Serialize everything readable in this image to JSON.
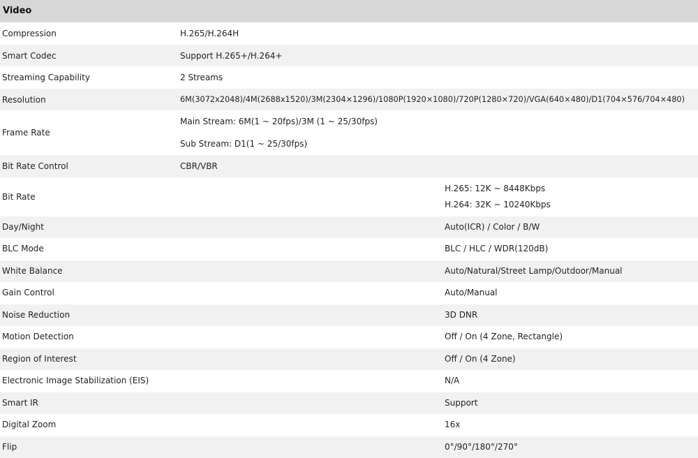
{
  "title": "Video",
  "rows": [
    {
      "label": "Compression",
      "values": [
        "H.265/H.264H"
      ]
    },
    {
      "label": "Smart Codec",
      "values": [
        "Support H.265+/H.264+"
      ]
    },
    {
      "label": "Streaming Capability",
      "values": [
        "2 Streams"
      ]
    },
    {
      "label": "Resolution",
      "values": [
        "6M(3072x2048)/4M(2688x1520)/3M(2304×1296)/1080P(1920×1080)/720P(1280×720)/VGA(640×480)/D1(704×576/704×480)"
      ]
    },
    {
      "label": "Frame Rate",
      "values": [
        "Main Stream: 6M(1 ~ 20fps)/3M (1 ~ 25/30fps)",
        "Sub Stream: D1(1 ~ 25/30fps)"
      ]
    },
    {
      "label": "Bit Rate Control",
      "values": [
        "CBR/VBR"
      ]
    },
    {
      "label": "Bit Rate",
      "values": [
        "H.265: 12K ~ 8448Kbps",
        "H.264: 32K ~ 10240Kbps"
      ]
    },
    {
      "label": "Day/Night",
      "values": [
        "Auto(ICR) / Color / B/W"
      ]
    },
    {
      "label": "BLC Mode",
      "values": [
        "BLC / HLC / WDR(120dB)"
      ]
    },
    {
      "label": "White Balance",
      "values": [
        "Auto/Natural/Street Lamp/Outdoor/Manual"
      ]
    },
    {
      "label": "Gain Control",
      "values": [
        "Auto/Manual"
      ]
    },
    {
      "label": "Noise Reduction",
      "values": [
        "3D DNR"
      ]
    },
    {
      "label": "Motion Detection",
      "values": [
        "Off / On (4 Zone, Rectangle)"
      ]
    },
    {
      "label": "Region of Interest",
      "values": [
        "Off / On (4 Zone)"
      ]
    },
    {
      "label": "Electronic Image Stabilization (EIS)",
      "values": [
        "N/A"
      ]
    },
    {
      "label": "Smart IR",
      "values": [
        "Support"
      ]
    },
    {
      "label": "Digital Zoom",
      "values": [
        "16x"
      ]
    },
    {
      "label": "Flip",
      "values": [
        "0°/90°/180°/270°"
      ]
    }
  ]
}
